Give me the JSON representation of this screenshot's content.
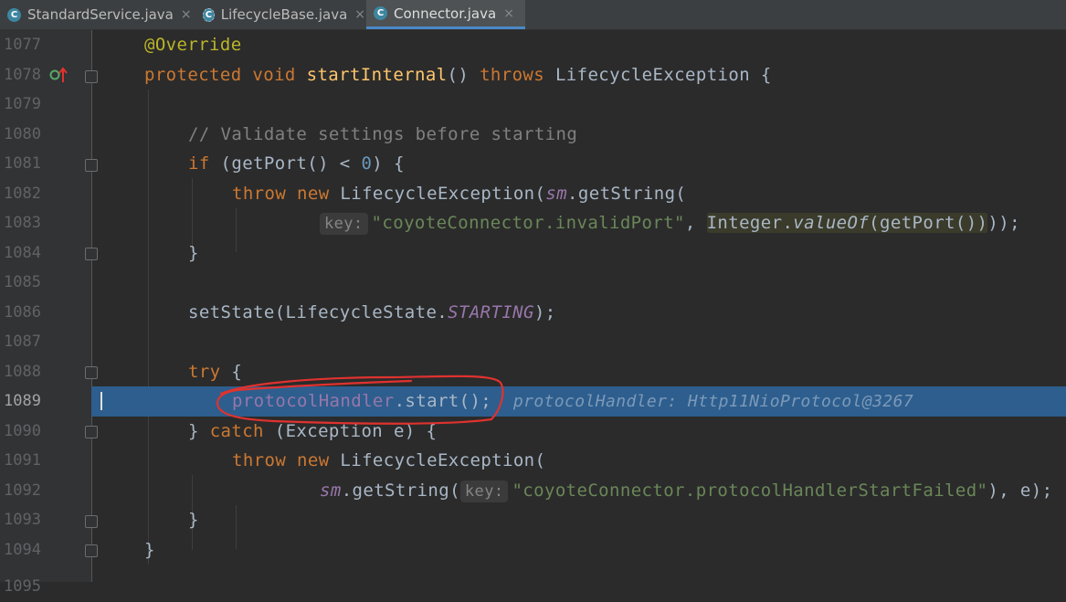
{
  "tabs": [
    {
      "label": "StandardService.java",
      "close": "×",
      "icon": "C"
    },
    {
      "label": "LifecycleBase.java",
      "close": "×",
      "icon": "C"
    },
    {
      "label": "Connector.java",
      "close": "×",
      "icon": "C"
    }
  ],
  "lines": {
    "l1077": "1077",
    "l1078": "1078",
    "l1079": "1079",
    "l1080": "1080",
    "l1081": "1081",
    "l1082": "1082",
    "l1083": "1083",
    "l1084": "1084",
    "l1085": "1085",
    "l1086": "1086",
    "l1087": "1087",
    "l1088": "1088",
    "l1089": "1089",
    "l1090": "1090",
    "l1091": "1091",
    "l1092": "1092",
    "l1093": "1093",
    "l1094": "1094",
    "l1095": "1095"
  },
  "code": {
    "override": "@Override",
    "protected": "protected",
    "void": "void",
    "startInternal": "startInternal",
    "paren1": "() ",
    "throws": "throws",
    "lifecycleExc1": " LifecycleException {",
    "comment": "// Validate settings before starting",
    "if": "if",
    "ifBody": " (getPort() < ",
    "zero": "0",
    "ifEnd": ") {",
    "throw1": "throw",
    "new1": "new",
    "lifecycleExc2": " LifecycleException(",
    "sm1": "sm",
    "getString1": ".getString(",
    "hintKey1": "key:",
    "str1": "\"coyoteConnector.invalidPort\"",
    "comma1": ", ",
    "integer": "Integer.",
    "valueOf": "valueOf",
    "getPortArg": "(getPort())",
    "end1": "));",
    "closeBrace1": "}",
    "setState": "setState(LifecycleState.",
    "starting": "STARTING",
    "setStateEnd": ");",
    "try": "try",
    "tryBrace": " {",
    "protocolHandler": "protocolHandler",
    "startCall": ".start();",
    "debugHint": "protocolHandler: Http11NioProtocol@3267",
    "closeBraceCatch": "} ",
    "catch": "catch",
    "catchBody": " (Exception e) {",
    "throw2": "throw",
    "new2": "new",
    "lifecycleExc3": " LifecycleException(",
    "sm2": "sm",
    "getString2": ".getString(",
    "hintKey2": "key:",
    "str2": "\"coyoteConnector.protocolHandlerStartFailed\"",
    "end2": "), e);",
    "closeBrace2": "}",
    "closeBrace3": "}"
  },
  "colors": {
    "highlight": "#2d5e8e",
    "annotationCircle": "#e0322f"
  }
}
